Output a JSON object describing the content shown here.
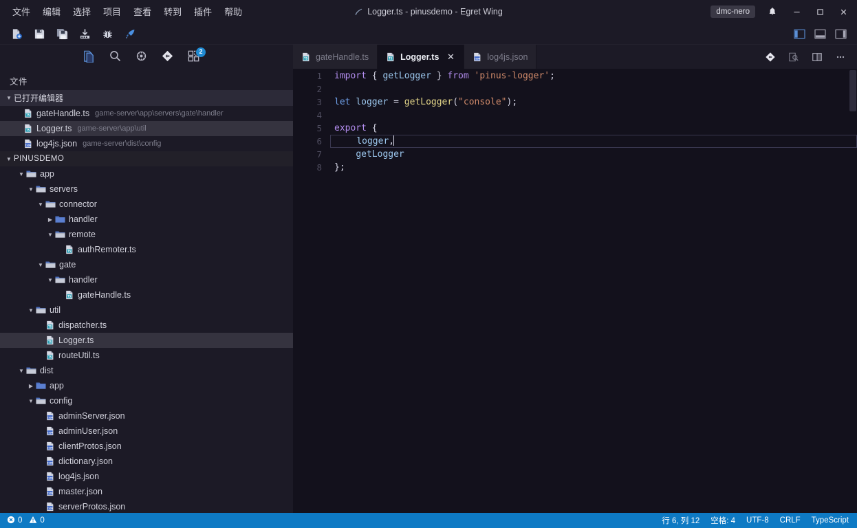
{
  "window": {
    "title": "Logger.ts - pinusdemo - Egret Wing",
    "user_badge": "dmc-nero",
    "icons": {
      "app": "egret-feather-icon",
      "bell": "bell-icon",
      "minimize": "minimize-icon",
      "maximize": "maximize-icon",
      "close": "close-icon"
    }
  },
  "menubar": {
    "items": [
      {
        "label": "文件",
        "name": "menu-file"
      },
      {
        "label": "编辑",
        "name": "menu-edit"
      },
      {
        "label": "选择",
        "name": "menu-selection"
      },
      {
        "label": "项目",
        "name": "menu-project"
      },
      {
        "label": "查看",
        "name": "menu-view"
      },
      {
        "label": "转到",
        "name": "menu-goto"
      },
      {
        "label": "插件",
        "name": "menu-plugins"
      },
      {
        "label": "帮助",
        "name": "menu-help"
      }
    ]
  },
  "toolbar": {
    "buttons": [
      {
        "icon": "new-file-icon",
        "name": "new-file-button"
      },
      {
        "icon": "save-icon",
        "name": "save-button"
      },
      {
        "icon": "save-all-icon",
        "name": "save-all-button"
      },
      {
        "icon": "publish-icon",
        "name": "publish-button"
      },
      {
        "icon": "debug-bug-icon",
        "name": "debug-button"
      },
      {
        "icon": "rocket-run-icon",
        "name": "run-button"
      }
    ],
    "layout_toggles": [
      {
        "icon": "toggle-sidebar-icon",
        "name": "toggle-sidebar-button",
        "active": true
      },
      {
        "icon": "toggle-panel-icon",
        "name": "toggle-panel-button",
        "active": false
      },
      {
        "icon": "toggle-right-sidebar-icon",
        "name": "toggle-right-sidebar-button",
        "active": false
      }
    ]
  },
  "activitybar": {
    "items": [
      {
        "icon": "files-explorer-icon",
        "name": "activity-explorer",
        "active": true,
        "badge": ""
      },
      {
        "icon": "search-icon",
        "name": "activity-search",
        "active": false,
        "badge": ""
      },
      {
        "icon": "debug-icon",
        "name": "activity-debug",
        "active": false,
        "badge": ""
      },
      {
        "icon": "source-control-icon",
        "name": "activity-source-control",
        "active": false,
        "badge": ""
      },
      {
        "icon": "extensions-icon",
        "name": "activity-extensions",
        "active": false,
        "badge": "2"
      }
    ]
  },
  "sidebar": {
    "title": "文件",
    "open_editors": {
      "label": "已打开编辑器",
      "files": [
        {
          "name": "gateHandle.ts",
          "path": "game-server\\app\\servers\\gate\\handler",
          "icon": "typescript-file-icon",
          "selected": false
        },
        {
          "name": "Logger.ts",
          "path": "game-server\\app\\util",
          "icon": "typescript-file-icon",
          "selected": true
        },
        {
          "name": "log4js.json",
          "path": "game-server\\dist\\config",
          "icon": "json-file-icon",
          "selected": false
        }
      ]
    },
    "project": {
      "label": "PINUSDEMO",
      "tree": [
        {
          "label": "app",
          "type": "folder",
          "depth": 1,
          "expanded": true,
          "icon": "folder-open-icon",
          "selected": false
        },
        {
          "label": "servers",
          "type": "folder",
          "depth": 2,
          "expanded": true,
          "icon": "folder-open-icon",
          "selected": false
        },
        {
          "label": "connector",
          "type": "folder",
          "depth": 3,
          "expanded": true,
          "icon": "folder-open-icon",
          "selected": false
        },
        {
          "label": "handler",
          "type": "folder",
          "depth": 4,
          "expanded": false,
          "icon": "folder-closed-icon",
          "selected": false
        },
        {
          "label": "remote",
          "type": "folder",
          "depth": 4,
          "expanded": true,
          "icon": "folder-open-icon",
          "selected": false
        },
        {
          "label": "authRemoter.ts",
          "type": "ts",
          "depth": 5,
          "expanded": null,
          "icon": "typescript-file-icon",
          "selected": false
        },
        {
          "label": "gate",
          "type": "folder",
          "depth": 3,
          "expanded": true,
          "icon": "folder-open-icon",
          "selected": false
        },
        {
          "label": "handler",
          "type": "folder",
          "depth": 4,
          "expanded": true,
          "icon": "folder-open-icon",
          "selected": false
        },
        {
          "label": "gateHandle.ts",
          "type": "ts",
          "depth": 5,
          "expanded": null,
          "icon": "typescript-file-icon",
          "selected": false
        },
        {
          "label": "util",
          "type": "folder",
          "depth": 2,
          "expanded": true,
          "icon": "folder-open-icon",
          "selected": false
        },
        {
          "label": "dispatcher.ts",
          "type": "ts",
          "depth": 3,
          "expanded": null,
          "icon": "typescript-file-icon",
          "selected": false
        },
        {
          "label": "Logger.ts",
          "type": "ts",
          "depth": 3,
          "expanded": null,
          "icon": "typescript-file-icon",
          "selected": true
        },
        {
          "label": "routeUtil.ts",
          "type": "ts",
          "depth": 3,
          "expanded": null,
          "icon": "typescript-file-icon",
          "selected": false
        },
        {
          "label": "dist",
          "type": "folder",
          "depth": 1,
          "expanded": true,
          "icon": "folder-open-icon",
          "selected": false
        },
        {
          "label": "app",
          "type": "folder",
          "depth": 2,
          "expanded": false,
          "icon": "folder-closed-icon",
          "selected": false
        },
        {
          "label": "config",
          "type": "folder",
          "depth": 2,
          "expanded": true,
          "icon": "folder-open-icon",
          "selected": false
        },
        {
          "label": "adminServer.json",
          "type": "json",
          "depth": 3,
          "expanded": null,
          "icon": "json-file-icon",
          "selected": false
        },
        {
          "label": "adminUser.json",
          "type": "json",
          "depth": 3,
          "expanded": null,
          "icon": "json-file-icon",
          "selected": false
        },
        {
          "label": "clientProtos.json",
          "type": "json",
          "depth": 3,
          "expanded": null,
          "icon": "json-file-icon",
          "selected": false
        },
        {
          "label": "dictionary.json",
          "type": "json",
          "depth": 3,
          "expanded": null,
          "icon": "json-file-icon",
          "selected": false
        },
        {
          "label": "log4js.json",
          "type": "json",
          "depth": 3,
          "expanded": null,
          "icon": "json-file-icon",
          "selected": false
        },
        {
          "label": "master.json",
          "type": "json",
          "depth": 3,
          "expanded": null,
          "icon": "json-file-icon",
          "selected": false
        },
        {
          "label": "serverProtos.json",
          "type": "json",
          "depth": 3,
          "expanded": null,
          "icon": "json-file-icon",
          "selected": false
        }
      ]
    }
  },
  "tabs": [
    {
      "label": "gateHandle.ts",
      "icon": "typescript-file-icon",
      "active": false,
      "closable": false
    },
    {
      "label": "Logger.ts",
      "icon": "typescript-file-icon",
      "active": true,
      "closable": true
    },
    {
      "label": "log4js.json",
      "icon": "json-file-icon",
      "active": false,
      "closable": false
    }
  ],
  "editor_actions": [
    {
      "icon": "source-control-icon",
      "name": "editor-source-control-button"
    },
    {
      "icon": "preview-icon",
      "name": "editor-preview-button"
    },
    {
      "icon": "split-editor-icon",
      "name": "split-editor-button"
    },
    {
      "icon": "more-actions-icon",
      "name": "editor-more-actions-button"
    }
  ],
  "code": {
    "language": "TypeScript",
    "line_numbers": [
      "1",
      "2",
      "3",
      "4",
      "5",
      "6",
      "7",
      "8"
    ],
    "current_line": 6,
    "lines": [
      {
        "n": 1,
        "tokens": [
          {
            "t": "import",
            "c": "kw"
          },
          {
            "t": " ",
            "c": "pun"
          },
          {
            "t": "{",
            "c": "pun"
          },
          {
            "t": " ",
            "c": "pun"
          },
          {
            "t": "getLogger",
            "c": "var"
          },
          {
            "t": " ",
            "c": "pun"
          },
          {
            "t": "}",
            "c": "pun"
          },
          {
            "t": " ",
            "c": "pun"
          },
          {
            "t": "from",
            "c": "kw"
          },
          {
            "t": " ",
            "c": "pun"
          },
          {
            "t": "'pinus-logger'",
            "c": "str"
          },
          {
            "t": ";",
            "c": "pun"
          }
        ]
      },
      {
        "n": 2,
        "tokens": []
      },
      {
        "n": 3,
        "tokens": [
          {
            "t": "let",
            "c": "kw2"
          },
          {
            "t": " ",
            "c": "pun"
          },
          {
            "t": "logger",
            "c": "var"
          },
          {
            "t": " ",
            "c": "pun"
          },
          {
            "t": "=",
            "c": "pun"
          },
          {
            "t": " ",
            "c": "pun"
          },
          {
            "t": "getLogger",
            "c": "fn"
          },
          {
            "t": "(",
            "c": "pun"
          },
          {
            "t": "\"console\"",
            "c": "str"
          },
          {
            "t": ")",
            "c": "pun"
          },
          {
            "t": ";",
            "c": "pun"
          }
        ]
      },
      {
        "n": 4,
        "tokens": []
      },
      {
        "n": 5,
        "tokens": [
          {
            "t": "export",
            "c": "kw"
          },
          {
            "t": " ",
            "c": "pun"
          },
          {
            "t": "{",
            "c": "pun"
          }
        ]
      },
      {
        "n": 6,
        "tokens": [
          {
            "t": "    ",
            "c": "pun"
          },
          {
            "t": "logger",
            "c": "var"
          },
          {
            "t": ",",
            "c": "pun"
          }
        ]
      },
      {
        "n": 7,
        "tokens": [
          {
            "t": "    ",
            "c": "pun"
          },
          {
            "t": "getLogger",
            "c": "var"
          }
        ]
      },
      {
        "n": 8,
        "tokens": [
          {
            "t": "}",
            "c": "pun"
          },
          {
            "t": ";",
            "c": "pun"
          }
        ]
      }
    ]
  },
  "statusbar": {
    "errors": "0",
    "warnings": "0",
    "cursor_position": "行 6, 列 12",
    "indentation": "空格: 4",
    "encoding": "UTF-8",
    "line_ending": "CRLF",
    "language": "TypeScript"
  },
  "colors": {
    "accent": "#0e7ac4",
    "titlebar_bg": "#1c1a26",
    "sidebar_bg": "#1c1a26",
    "editor_bg": "#13111c",
    "badge_blue": "#1f8ad2"
  }
}
